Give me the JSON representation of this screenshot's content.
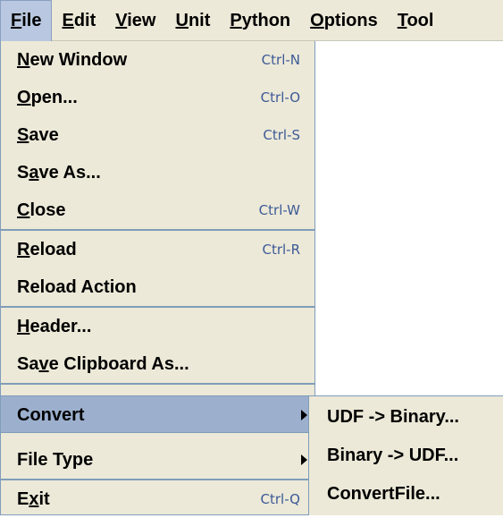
{
  "menubar": {
    "items": [
      {
        "mnemonic": "F",
        "rest": "ile"
      },
      {
        "mnemonic": "E",
        "rest": "dit"
      },
      {
        "mnemonic": "V",
        "rest": "iew"
      },
      {
        "mnemonic": "U",
        "rest": "nit"
      },
      {
        "mnemonic": "P",
        "rest": "ython"
      },
      {
        "mnemonic": "O",
        "rest": "ptions"
      },
      {
        "mnemonic": "T",
        "rest": "ool"
      }
    ]
  },
  "file_menu": {
    "new_window": {
      "pre": "",
      "mn": "N",
      "post": "ew Window",
      "accel": "Ctrl-N"
    },
    "open": {
      "pre": "",
      "mn": "O",
      "post": "pen...",
      "accel": "Ctrl-O"
    },
    "save": {
      "pre": "",
      "mn": "S",
      "post": "ave",
      "accel": "Ctrl-S"
    },
    "save_as": {
      "pre": "S",
      "mn": "a",
      "post": "ve As..."
    },
    "close": {
      "pre": "",
      "mn": "C",
      "post": "lose",
      "accel": "Ctrl-W"
    },
    "reload": {
      "pre": "",
      "mn": "R",
      "post": "eload",
      "accel": "Ctrl-R"
    },
    "reload_action": {
      "label": "Reload Action"
    },
    "header": {
      "pre": "",
      "mn": "H",
      "post": "eader..."
    },
    "save_clipboard": {
      "pre": "Sa",
      "mn": "v",
      "post": "e Clipboard As..."
    },
    "convert": {
      "label": "Convert"
    },
    "file_type": {
      "label": "File Type"
    },
    "exit": {
      "pre": "E",
      "mn": "x",
      "post": "it",
      "accel": "Ctrl-Q"
    }
  },
  "convert_submenu": {
    "items": [
      "UDF -> Binary...",
      "Binary -> UDF...",
      "ConvertFile..."
    ]
  }
}
